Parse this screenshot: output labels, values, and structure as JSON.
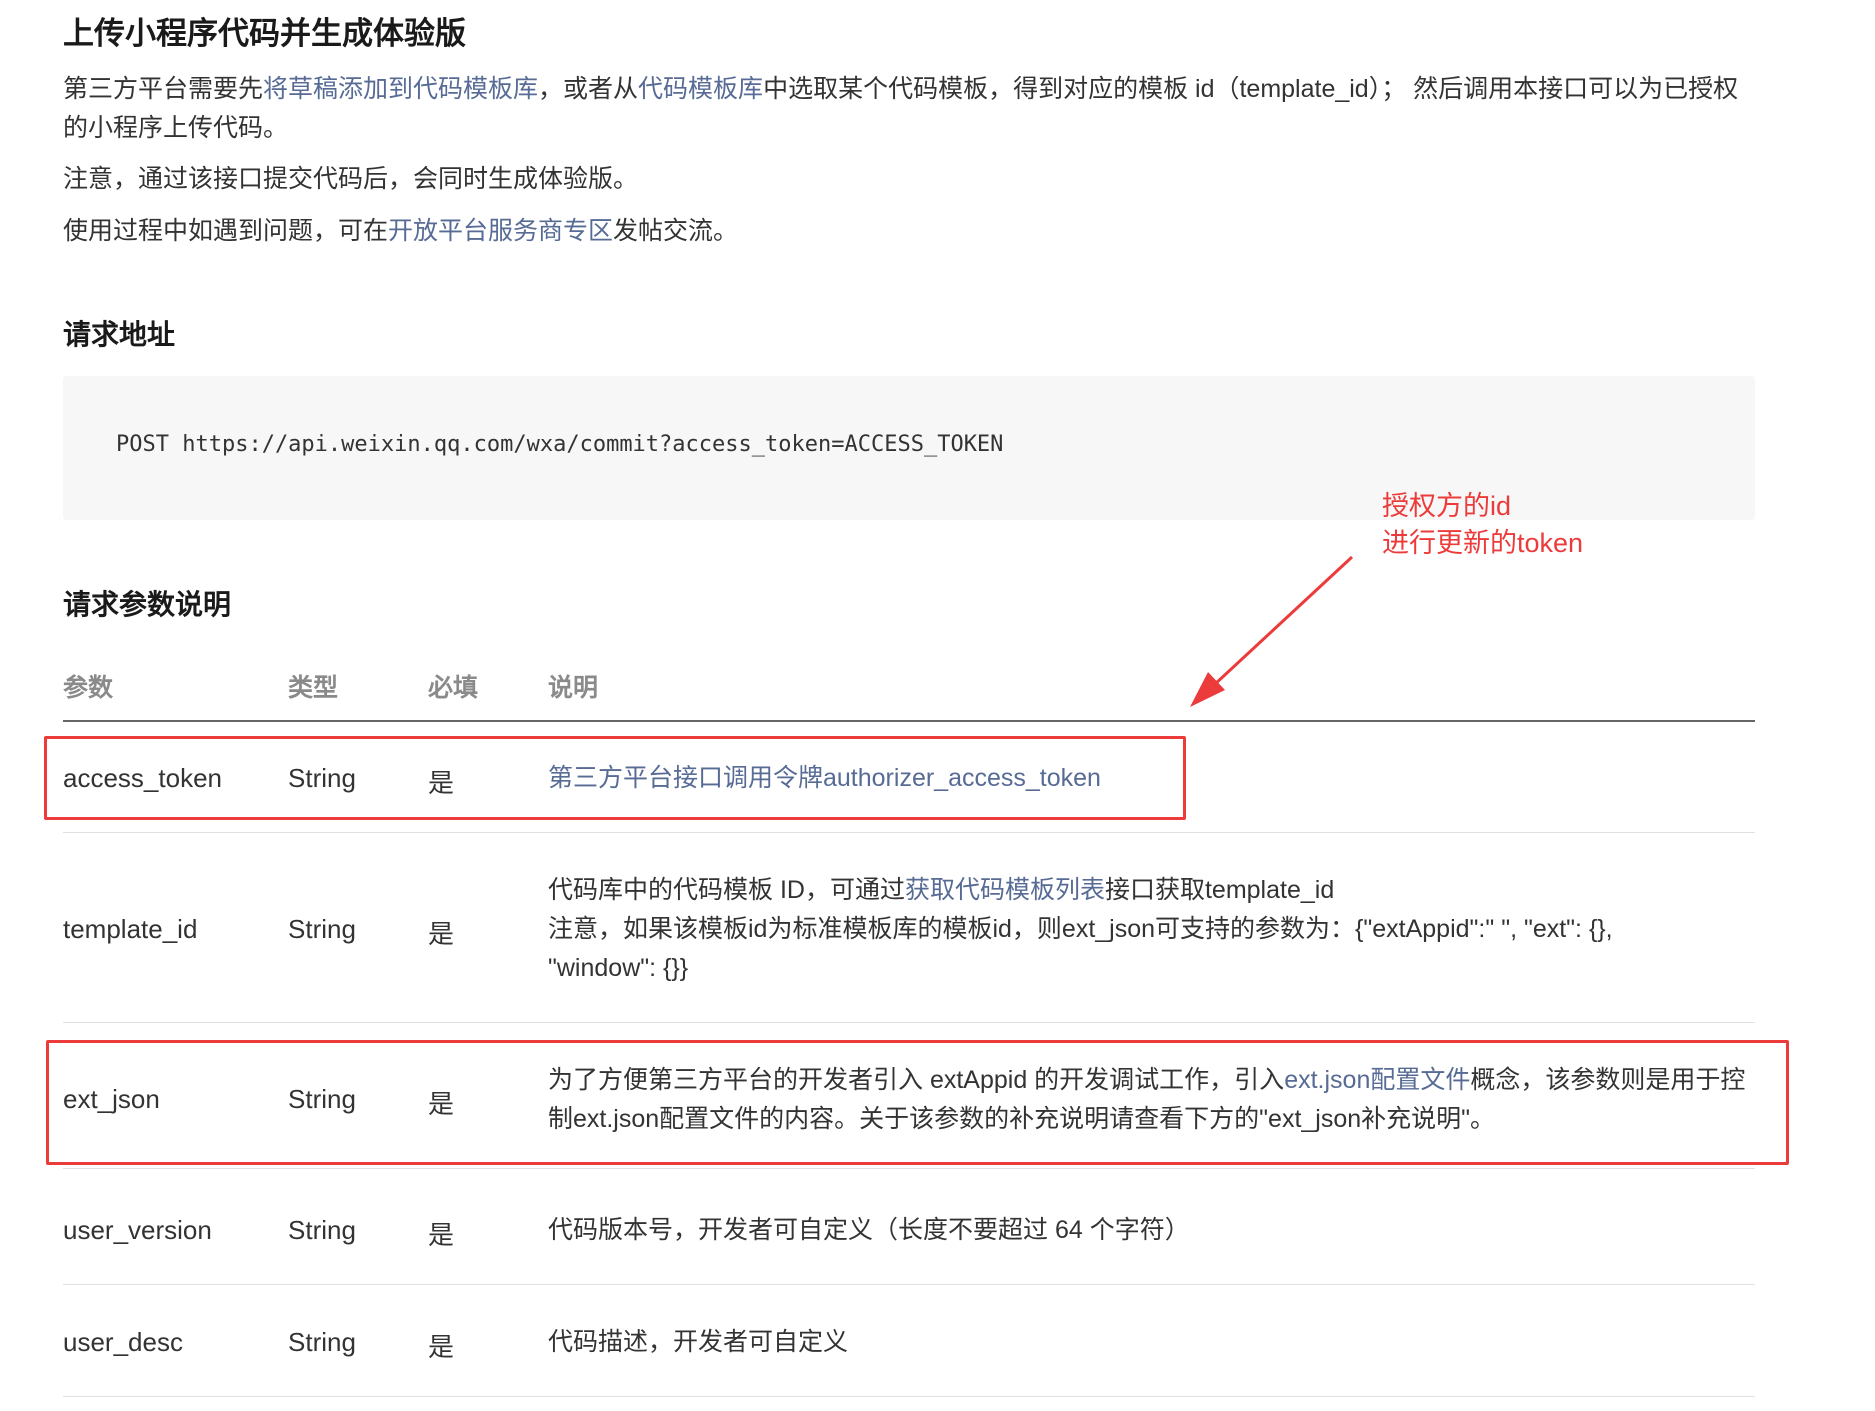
{
  "page": {
    "title": "上传小程序代码并生成体验版",
    "intro": {
      "p1_a": "第三方平台需要先",
      "p1_link1": "将草稿添加到代码模板库",
      "p1_b": "，或者从",
      "p1_link2": "代码模板库",
      "p1_c": "中选取某个代码模板，得到对应的模板 id（template_id）； 然后调用本接口可以为已授权的小程序上传代码。",
      "p2": "注意，通过该接口提交代码后，会同时生成体验版。",
      "p3_a": "使用过程中如遇到问题，可在",
      "p3_link": "开放平台服务商专区",
      "p3_b": "发帖交流。"
    },
    "request_url": {
      "heading": "请求地址",
      "code": "POST https://api.weixin.qq.com/wxa/commit?access_token=ACCESS_TOKEN"
    },
    "params": {
      "heading": "请求参数说明",
      "headers": [
        "参数",
        "类型",
        "必填",
        "说明"
      ],
      "rows": [
        {
          "name": "access_token",
          "type": "String",
          "required": "是",
          "desc_link": "第三方平台接口调用令牌authorizer_access_token"
        },
        {
          "name": "template_id",
          "type": "String",
          "required": "是",
          "desc_line1_a": "代码库中的代码模板 ID，可通过",
          "desc_line1_link": "获取代码模板列表",
          "desc_line1_b": "接口获取template_id",
          "desc_rest": "注意，如果该模板id为标准模板库的模板id，则ext_json可支持的参数为：{\"extAppid\":\" \", \"ext\": {}, \"window\": {}}"
        },
        {
          "name": "ext_json",
          "type": "String",
          "required": "是",
          "desc_a": "为了方便第三方平台的开发者引入 extAppid 的开发调试工作，引入",
          "desc_link": "ext.json配置文件",
          "desc_b": "概念，该参数则是用于控制ext.json配置文件的内容。关于该参数的补充说明请查看下方的\"ext_json补充说明\"。"
        },
        {
          "name": "user_version",
          "type": "String",
          "required": "是",
          "desc": "代码版本号，开发者可自定义（长度不要超过 64 个字符）"
        },
        {
          "name": "user_desc",
          "type": "String",
          "required": "是",
          "desc": "代码描述，开发者可自定义"
        }
      ]
    },
    "annotation": {
      "line1": "授权方的id",
      "line2": "进行更新的token",
      "color": "#ec3b3b"
    },
    "colors": {
      "link": "#576b95",
      "code_bg": "#f7f7f7",
      "header_text": "#8a8a8a"
    }
  }
}
